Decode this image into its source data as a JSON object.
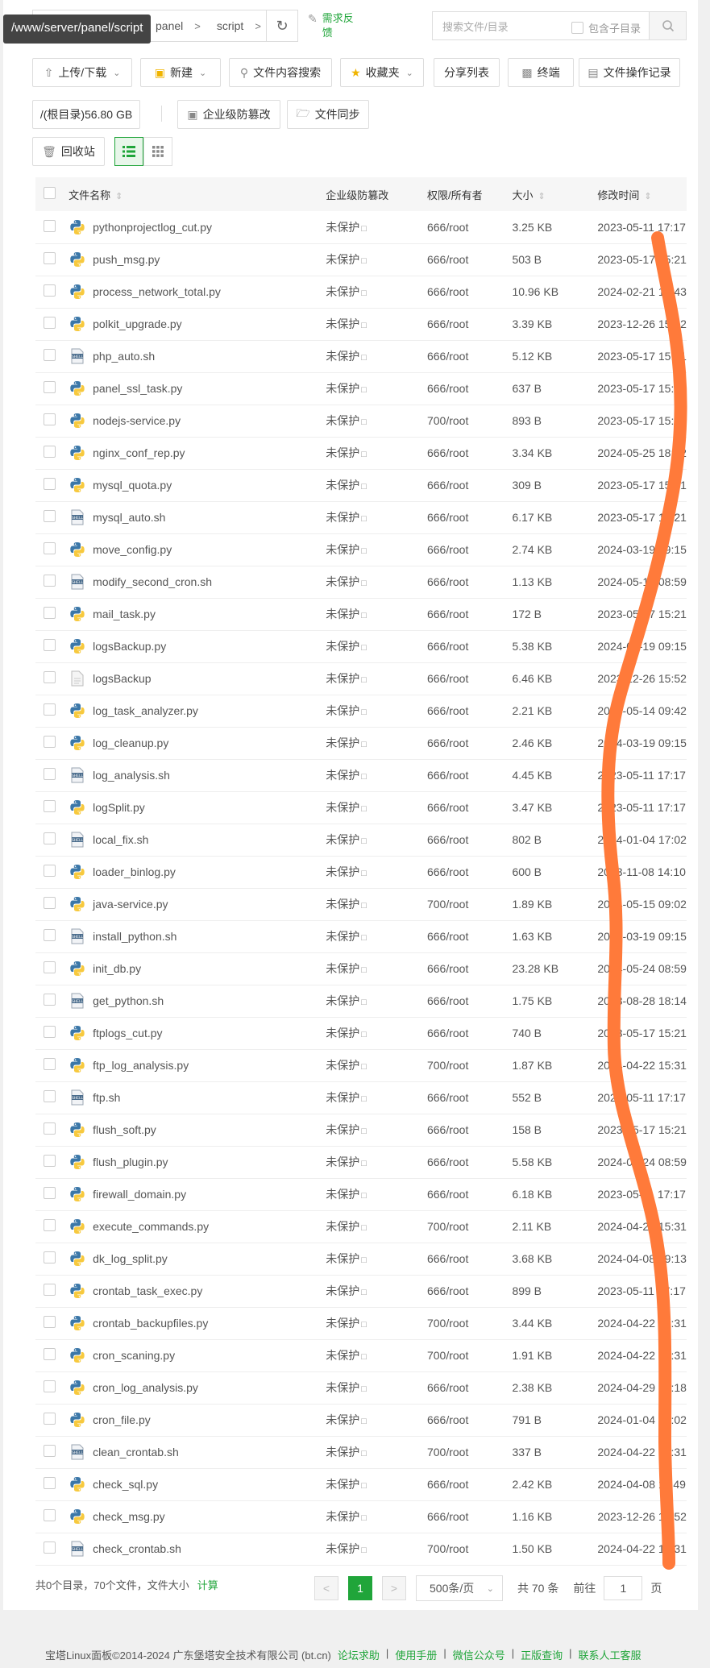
{
  "path_tooltip": "/www/server/panel/script",
  "breadcrumb": [
    "panel",
    "script"
  ],
  "feedback_label": "需求反馈",
  "search": {
    "placeholder": "搜索文件/目录",
    "include_sub": "包含子目录"
  },
  "toolbar": {
    "upload": "上传/下载",
    "new": "新建",
    "content_search": "文件内容搜索",
    "favorites": "收藏夹",
    "share_list": "分享列表",
    "terminal": "终端",
    "op_log": "文件操作记录",
    "root_disk": "/(根目录)56.80 GB",
    "tamper": "企业级防篡改",
    "sync": "文件同步",
    "recycle": "回收站"
  },
  "columns": {
    "name": "文件名称",
    "protect": "企业级防篡改",
    "perm": "权限/所有者",
    "size": "大小",
    "mtime": "修改时间"
  },
  "files": [
    {
      "name": "pythonprojectlog_cut.py",
      "type": "py",
      "protect": "未保护",
      "perm": "666/root",
      "size": "3.25 KB",
      "mtime": "2023-05-11 17:17"
    },
    {
      "name": "push_msg.py",
      "type": "py",
      "protect": "未保护",
      "perm": "666/root",
      "size": "503 B",
      "mtime": "2023-05-17 15:21"
    },
    {
      "name": "process_network_total.py",
      "type": "py",
      "protect": "未保护",
      "perm": "666/root",
      "size": "10.96 KB",
      "mtime": "2024-02-21 17:43"
    },
    {
      "name": "polkit_upgrade.py",
      "type": "py",
      "protect": "未保护",
      "perm": "666/root",
      "size": "3.39 KB",
      "mtime": "2023-12-26 15:52"
    },
    {
      "name": "php_auto.sh",
      "type": "sh",
      "protect": "未保护",
      "perm": "666/root",
      "size": "5.12 KB",
      "mtime": "2023-05-17 15:21"
    },
    {
      "name": "panel_ssl_task.py",
      "type": "py",
      "protect": "未保护",
      "perm": "666/root",
      "size": "637 B",
      "mtime": "2023-05-17 15:21"
    },
    {
      "name": "nodejs-service.py",
      "type": "py",
      "protect": "未保护",
      "perm": "700/root",
      "size": "893 B",
      "mtime": "2023-05-17 15:21"
    },
    {
      "name": "nginx_conf_rep.py",
      "type": "py",
      "protect": "未保护",
      "perm": "666/root",
      "size": "3.34 KB",
      "mtime": "2024-05-25 18:22"
    },
    {
      "name": "mysql_quota.py",
      "type": "py",
      "protect": "未保护",
      "perm": "666/root",
      "size": "309 B",
      "mtime": "2023-05-17 15:21"
    },
    {
      "name": "mysql_auto.sh",
      "type": "sh",
      "protect": "未保护",
      "perm": "666/root",
      "size": "6.17 KB",
      "mtime": "2023-05-17 15:21"
    },
    {
      "name": "move_config.py",
      "type": "py",
      "protect": "未保护",
      "perm": "666/root",
      "size": "2.74 KB",
      "mtime": "2024-03-19 09:15"
    },
    {
      "name": "modify_second_cron.sh",
      "type": "sh",
      "protect": "未保护",
      "perm": "666/root",
      "size": "1.13 KB",
      "mtime": "2024-05-17 08:59"
    },
    {
      "name": "mail_task.py",
      "type": "py",
      "protect": "未保护",
      "perm": "666/root",
      "size": "172 B",
      "mtime": "2023-05-17 15:21"
    },
    {
      "name": "logsBackup.py",
      "type": "py",
      "protect": "未保护",
      "perm": "666/root",
      "size": "5.38 KB",
      "mtime": "2024-03-19 09:15"
    },
    {
      "name": "logsBackup",
      "type": "file",
      "protect": "未保护",
      "perm": "666/root",
      "size": "6.46 KB",
      "mtime": "2023-12-26 15:52"
    },
    {
      "name": "log_task_analyzer.py",
      "type": "py",
      "protect": "未保护",
      "perm": "666/root",
      "size": "2.21 KB",
      "mtime": "2024-05-14 09:42"
    },
    {
      "name": "log_cleanup.py",
      "type": "py",
      "protect": "未保护",
      "perm": "666/root",
      "size": "2.46 KB",
      "mtime": "2024-03-19 09:15"
    },
    {
      "name": "log_analysis.sh",
      "type": "sh",
      "protect": "未保护",
      "perm": "666/root",
      "size": "4.45 KB",
      "mtime": "2023-05-11 17:17"
    },
    {
      "name": "logSplit.py",
      "type": "py",
      "protect": "未保护",
      "perm": "666/root",
      "size": "3.47 KB",
      "mtime": "2023-05-11 17:17"
    },
    {
      "name": "local_fix.sh",
      "type": "sh",
      "protect": "未保护",
      "perm": "666/root",
      "size": "802 B",
      "mtime": "2024-01-04 17:02"
    },
    {
      "name": "loader_binlog.py",
      "type": "py",
      "protect": "未保护",
      "perm": "666/root",
      "size": "600 B",
      "mtime": "2023-11-08 14:10"
    },
    {
      "name": "java-service.py",
      "type": "py",
      "protect": "未保护",
      "perm": "700/root",
      "size": "1.89 KB",
      "mtime": "2024-05-15 09:02"
    },
    {
      "name": "install_python.sh",
      "type": "sh",
      "protect": "未保护",
      "perm": "666/root",
      "size": "1.63 KB",
      "mtime": "2024-03-19 09:15"
    },
    {
      "name": "init_db.py",
      "type": "py",
      "protect": "未保护",
      "perm": "666/root",
      "size": "23.28 KB",
      "mtime": "2024-05-24 08:59"
    },
    {
      "name": "get_python.sh",
      "type": "sh",
      "protect": "未保护",
      "perm": "666/root",
      "size": "1.75 KB",
      "mtime": "2023-08-28 18:14"
    },
    {
      "name": "ftplogs_cut.py",
      "type": "py",
      "protect": "未保护",
      "perm": "666/root",
      "size": "740 B",
      "mtime": "2023-05-17 15:21"
    },
    {
      "name": "ftp_log_analysis.py",
      "type": "py",
      "protect": "未保护",
      "perm": "700/root",
      "size": "1.87 KB",
      "mtime": "2024-04-22 15:31"
    },
    {
      "name": "ftp.sh",
      "type": "sh",
      "protect": "未保护",
      "perm": "666/root",
      "size": "552 B",
      "mtime": "2023-05-11 17:17"
    },
    {
      "name": "flush_soft.py",
      "type": "py",
      "protect": "未保护",
      "perm": "666/root",
      "size": "158 B",
      "mtime": "2023-05-17 15:21"
    },
    {
      "name": "flush_plugin.py",
      "type": "py",
      "protect": "未保护",
      "perm": "666/root",
      "size": "5.58 KB",
      "mtime": "2024-05-24 08:59"
    },
    {
      "name": "firewall_domain.py",
      "type": "py",
      "protect": "未保护",
      "perm": "666/root",
      "size": "6.18 KB",
      "mtime": "2023-05-11 17:17"
    },
    {
      "name": "execute_commands.py",
      "type": "py",
      "protect": "未保护",
      "perm": "700/root",
      "size": "2.11 KB",
      "mtime": "2024-04-22 15:31"
    },
    {
      "name": "dk_log_split.py",
      "type": "py",
      "protect": "未保护",
      "perm": "666/root",
      "size": "3.68 KB",
      "mtime": "2024-04-08 09:13"
    },
    {
      "name": "crontab_task_exec.py",
      "type": "py",
      "protect": "未保护",
      "perm": "666/root",
      "size": "899 B",
      "mtime": "2023-05-11 17:17"
    },
    {
      "name": "crontab_backupfiles.py",
      "type": "py",
      "protect": "未保护",
      "perm": "700/root",
      "size": "3.44 KB",
      "mtime": "2024-04-22 15:31"
    },
    {
      "name": "cron_scaning.py",
      "type": "py",
      "protect": "未保护",
      "perm": "700/root",
      "size": "1.91 KB",
      "mtime": "2024-04-22 15:31"
    },
    {
      "name": "cron_log_analysis.py",
      "type": "py",
      "protect": "未保护",
      "perm": "666/root",
      "size": "2.38 KB",
      "mtime": "2024-04-29 15:18"
    },
    {
      "name": "cron_file.py",
      "type": "py",
      "protect": "未保护",
      "perm": "666/root",
      "size": "791 B",
      "mtime": "2024-01-04 17:02"
    },
    {
      "name": "clean_crontab.sh",
      "type": "sh",
      "protect": "未保护",
      "perm": "700/root",
      "size": "337 B",
      "mtime": "2024-04-22 15:31"
    },
    {
      "name": "check_sql.py",
      "type": "py",
      "protect": "未保护",
      "perm": "666/root",
      "size": "2.42 KB",
      "mtime": "2024-04-08 11:49"
    },
    {
      "name": "check_msg.py",
      "type": "py",
      "protect": "未保护",
      "perm": "666/root",
      "size": "1.16 KB",
      "mtime": "2023-12-26 15:52"
    },
    {
      "name": "check_crontab.sh",
      "type": "sh",
      "protect": "未保护",
      "perm": "700/root",
      "size": "1.50 KB",
      "mtime": "2024-04-22 15:31"
    }
  ],
  "summary": {
    "text": "共0个目录，70个文件，文件大小",
    "calc": "计算"
  },
  "pagination": {
    "current": "1",
    "per_page": "500条/页",
    "total": "共 70 条",
    "goto_prefix": "前往",
    "goto_value": "1",
    "goto_suffix": "页"
  },
  "copyright": {
    "text": "宝塔Linux面板©2014-2024 广东堡塔安全技术有限公司 (bt.cn)",
    "links": [
      "论坛求助",
      "使用手册",
      "微信公众号",
      "正版查询",
      "联系人工客服"
    ]
  },
  "colors": {
    "accent": "#20a53a",
    "scribble": "#ff7a3a"
  }
}
